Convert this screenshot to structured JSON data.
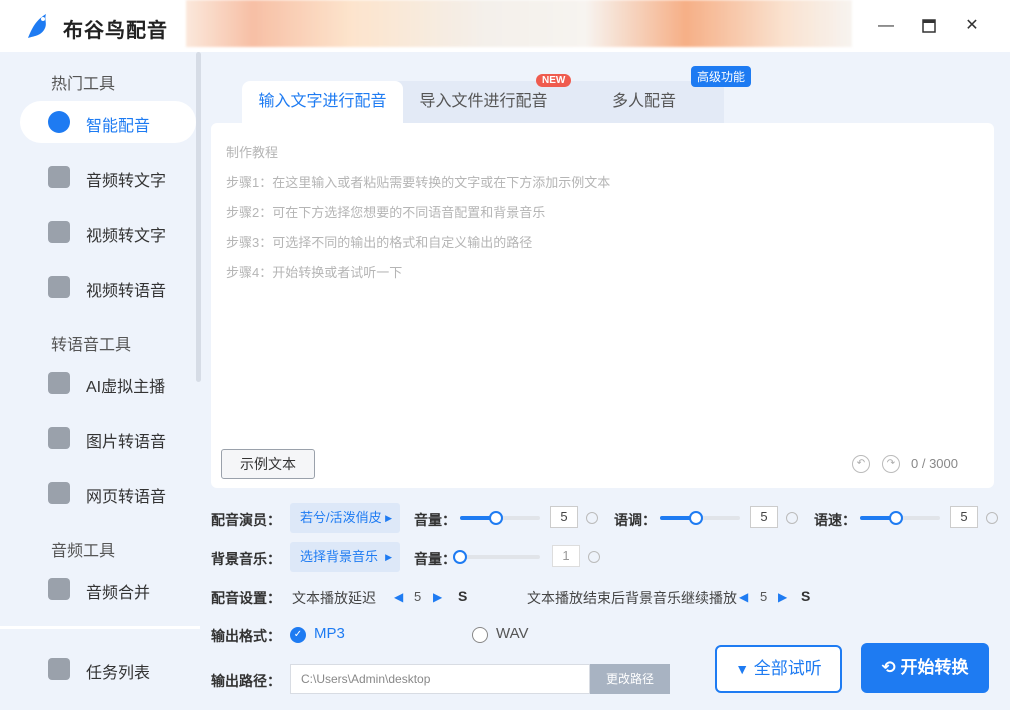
{
  "app": {
    "title": "布谷鸟配音",
    "window_buttons": [
      "minimize-icon",
      "maximize-icon",
      "close-icon"
    ]
  },
  "sidebar": {
    "sections": [
      "热门工具",
      "转语音工具",
      "音频工具"
    ],
    "items": [
      {
        "label": "智能配音",
        "icon": "smart-dub-icon",
        "active": true
      },
      {
        "label": "音频转文字",
        "icon": "audio-to-text-icon"
      },
      {
        "label": "视频转文字",
        "icon": "video-to-text-icon"
      },
      {
        "label": "视频转语音",
        "icon": "video-to-voice-icon"
      },
      {
        "label": "AI虚拟主播",
        "icon": "ai-anchor-icon"
      },
      {
        "label": "图片转语音",
        "icon": "image-to-voice-icon"
      },
      {
        "label": "网页转语音",
        "icon": "web-to-voice-icon"
      },
      {
        "label": "音频合并",
        "icon": "audio-merge-icon"
      }
    ],
    "task_list": "任务列表"
  },
  "tabs": [
    {
      "label": "输入文字进行配音",
      "active": true
    },
    {
      "label": "导入文件进行配音",
      "badge": "NEW"
    },
    {
      "label": "多人配音",
      "badge": "高级功能"
    }
  ],
  "editor": {
    "tutorial": [
      "制作教程",
      "步骤1：在这里输入或者粘贴需要转换的文字或在下方添加示例文本",
      "步骤2：可在下方选择您想要的不同语音配置和背景音乐",
      "步骤3：可选择不同的输出的格式和自定义输出的路径",
      "步骤4：开始转换或者试听一下"
    ],
    "sample_button": "示例文本",
    "char_count": "0 / 3000"
  },
  "controls": {
    "voice_actor_label": "配音演员：",
    "voice_actor_value": "若兮/活泼俏皮",
    "volume_label": "音量：",
    "volume_value": "5",
    "pitch_label": "语调：",
    "pitch_value": "5",
    "speed_label": "语速：",
    "speed_value": "5",
    "bgm_label": "背景音乐：",
    "bgm_value": "选择背景音乐",
    "bgm_volume_label": "音量：",
    "bgm_volume_value": "1",
    "dub_settings_label": "配音设置：",
    "text_delay_label": "文本播放延迟",
    "text_delay_value": "5",
    "bgm_continue_label": "文本播放结束后背景音乐继续播放",
    "bgm_continue_value": "5",
    "unit": "S",
    "format_label": "输出格式：",
    "formats": [
      {
        "label": "MP3",
        "selected": true
      },
      {
        "label": "WAV",
        "selected": false
      }
    ],
    "path_label": "输出路径：",
    "path_value": "C:\\Users\\Admin\\desktop",
    "change_path": "更改路径"
  },
  "actions": {
    "listen_all": "全部试听",
    "start": "开始转换"
  },
  "levels": {
    "volume": 0.45,
    "pitch": 0.45,
    "speed": 0.45,
    "bgm_volume": 0.0
  },
  "colors": {
    "accent": "#1e7bf2",
    "new_badge": "#ef5b4e"
  }
}
